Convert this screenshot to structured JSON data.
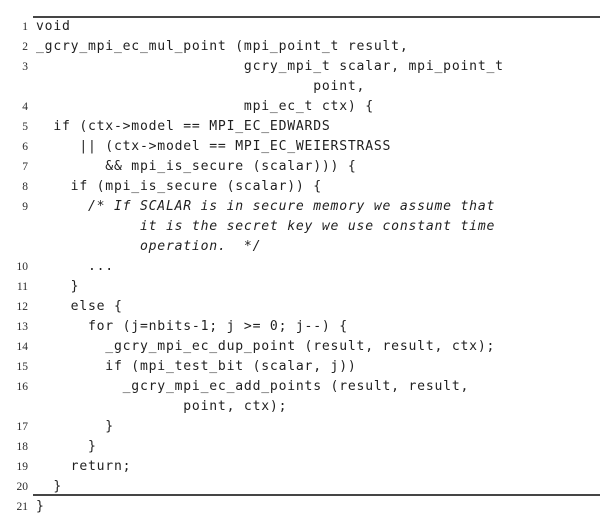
{
  "figure": {
    "kind": "code-listing",
    "language": "C",
    "rules": {
      "top_visible": true,
      "bottom_visible": true,
      "color": "#454545"
    }
  },
  "code": {
    "first_line_number": 1,
    "last_line_number": 21,
    "lines": [
      {
        "number": "1",
        "text": "void",
        "style": "code"
      },
      {
        "number": "2",
        "text": "_gcry_mpi_ec_mul_point (mpi_point_t result,",
        "style": "code"
      },
      {
        "number": "3",
        "text": "                        gcry_mpi_t scalar, mpi_point_t",
        "style": "code"
      },
      {
        "number": "",
        "text": "                                point,",
        "style": "code"
      },
      {
        "number": "4",
        "text": "                        mpi_ec_t ctx) {",
        "style": "code"
      },
      {
        "number": "5",
        "text": "  if (ctx->model == MPI_EC_EDWARDS",
        "style": "code"
      },
      {
        "number": "6",
        "text": "     || (ctx->model == MPI_EC_WEIERSTRASS",
        "style": "code"
      },
      {
        "number": "7",
        "text": "        && mpi_is_secure (scalar))) {",
        "style": "code"
      },
      {
        "number": "8",
        "text": "    if (mpi_is_secure (scalar)) {",
        "style": "code"
      },
      {
        "number": "9",
        "text": "      /* If SCALAR is in secure memory we assume that",
        "style": "comment"
      },
      {
        "number": "",
        "text": "            it is the secret key we use constant time",
        "style": "comment"
      },
      {
        "number": "",
        "text": "            operation.  */",
        "style": "comment"
      },
      {
        "number": "10",
        "text": "      ...",
        "style": "code"
      },
      {
        "number": "11",
        "text": "    }",
        "style": "code"
      },
      {
        "number": "12",
        "text": "    else {",
        "style": "code"
      },
      {
        "number": "13",
        "text": "      for (j=nbits-1; j >= 0; j--) {",
        "style": "code"
      },
      {
        "number": "14",
        "text": "        _gcry_mpi_ec_dup_point (result, result, ctx);",
        "style": "code"
      },
      {
        "number": "15",
        "text": "        if (mpi_test_bit (scalar, j))",
        "style": "code"
      },
      {
        "number": "16",
        "text": "          _gcry_mpi_ec_add_points (result, result,",
        "style": "code"
      },
      {
        "number": "",
        "text": "                 point, ctx);",
        "style": "code"
      },
      {
        "number": "17",
        "text": "        }",
        "style": "code"
      },
      {
        "number": "18",
        "text": "      }",
        "style": "code"
      },
      {
        "number": "19",
        "text": "    return;",
        "style": "code"
      },
      {
        "number": "20",
        "text": "  }",
        "style": "code"
      },
      {
        "number": "21",
        "text": "}",
        "style": "code"
      }
    ]
  }
}
